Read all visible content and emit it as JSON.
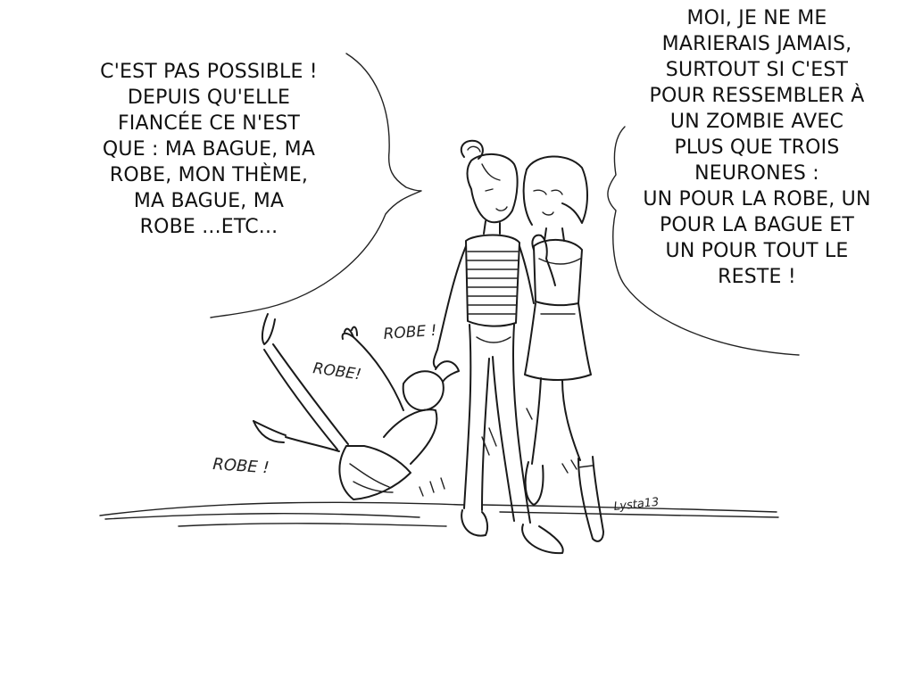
{
  "bubbles": {
    "left": "C'EST PAS POSSIBLE !\nDEPUIS QU'ELLE\nFIANCÉE CE N'EST\nQUE : MA BAGUE, MA\nROBE, MON THÈME,\nMA BAGUE, MA\nROBE ...ETC...",
    "right": "MOI, JE NE ME\nMARIERAIS JAMAIS,\nSURTOUT SI C'EST\nPOUR RESSEMBLER À\nUN ZOMBIE AVEC\nPLUS QUE TROIS\nNEURONES :\nUN POUR LA ROBE, UN\nPOUR LA BAGUE ET\nUN POUR TOUT LE\nRESTE !"
  },
  "sound_effects": {
    "robe_top": "ROBE !",
    "robe_middle": "ROBE!",
    "robe_bottom": "ROBE !"
  },
  "signature": "Lysta13",
  "icons": [
    "speech-bubble-left",
    "speech-bubble-right",
    "woman-striped-shirt",
    "woman-skirt",
    "falling-bride"
  ],
  "colors": {
    "ink": "#1a1a1a",
    "paper": "#ffffff"
  }
}
